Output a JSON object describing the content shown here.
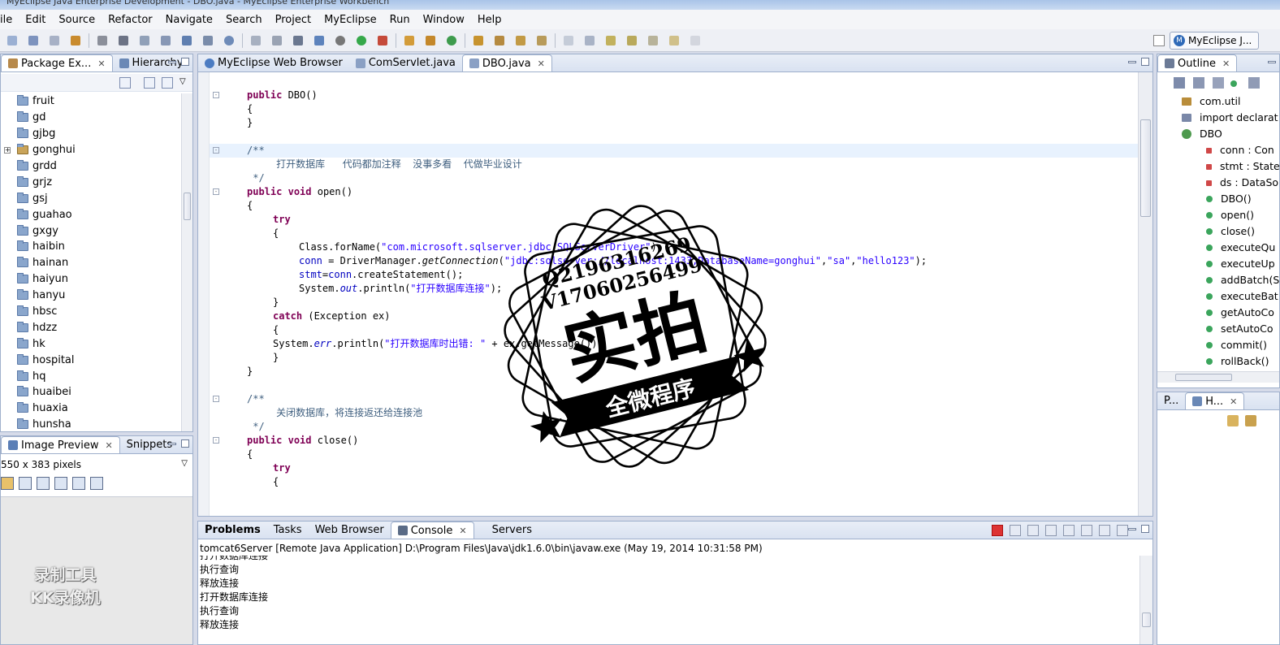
{
  "window": {
    "title": "MyEclipse Java Enterprise Development - DBO.java - MyEclipse Enterprise Workbench"
  },
  "menu": [
    "ile",
    "Edit",
    "Source",
    "Refactor",
    "Navigate",
    "Search",
    "Project",
    "MyEclipse",
    "Run",
    "Window",
    "Help"
  ],
  "perspective": {
    "label": "MyEclipse J..."
  },
  "package_explorer": {
    "tabs": [
      "Package Ex...",
      "Hierarchy"
    ],
    "items": [
      "fruit",
      "gd",
      "gjbg",
      "gonghui",
      "grdd",
      "grjz",
      "gsj",
      "guahao",
      "gxgy",
      "haibin",
      "hainan",
      "haiyun",
      "hanyu",
      "hbsc",
      "hdzz",
      "hk",
      "hospital",
      "hq",
      "huaibei",
      "huaxia",
      "hunsha"
    ]
  },
  "image_preview": {
    "tabs": [
      "Image Preview",
      "Snippets"
    ],
    "size_text": "550 x 383 pixels",
    "watermark": [
      "录制工具",
      "KK录像机"
    ]
  },
  "editor": {
    "tabs": [
      "MyEclipse Web Browser",
      "ComServlet.java",
      "DBO.java"
    ],
    "code": {
      "l01_kw": "public",
      "l01_rest": " DBO()",
      "l02": "{",
      "l03": "}",
      "l05": "/**",
      "l06": "     打开数据库   代码都加注释  没事多看  代做毕业设计",
      "l07": " */",
      "l08_kw1": "public",
      "l08_kw2": "void",
      "l08_rest": " open()",
      "l09": "{",
      "l10_kw": "try",
      "l11": "{",
      "l12_a": "Class.forName(",
      "l12_str": "\"com.microsoft.sqlserver.jdbc.SQLServerDriver\"",
      "l12_b": ");",
      "l13_fld": "conn",
      "l13_a": " = DriverManager.",
      "l13_it": "getConnection",
      "l13_b": "(",
      "l13_str1": "\"jdbc:sqlserver://localhost:1433;DatabaseName=gonghui\"",
      "l13_c": ",",
      "l13_str2": "\"sa\"",
      "l13_d": ",",
      "l13_str3": "\"hello123\"",
      "l13_e": ");",
      "l14_fld": "stmt",
      "l14_a": "=",
      "l14_fld2": "conn",
      "l14_b": ".createStatement();",
      "l15_a": "System.",
      "l15_fld": "out",
      "l15_b": ".println(",
      "l15_str": "\"打开数据库连接\"",
      "l15_c": ");",
      "l16": "}",
      "l17_kw": "catch",
      "l17_rest": " (Exception ex)",
      "l18": "{",
      "l19_a": "System.",
      "l19_fld": "err",
      "l19_b": ".println(",
      "l19_str": "\"打开数据库时出错: \"",
      "l19_c": " + ex.getMessage());",
      "l20": "}",
      "l21": "}",
      "l23": "/**",
      "l24": "     关闭数据库，将连接返还给连接池",
      "l25": " */",
      "l26_kw1": "public",
      "l26_kw2": "void",
      "l26_rest": " close()",
      "l27": "{",
      "l28_kw": "try",
      "l29": "{"
    }
  },
  "console": {
    "tabs": [
      "Problems",
      "Tasks",
      "Web Browser",
      "Console",
      "Servers"
    ],
    "header": "tomcat6Server [Remote Java Application] D:\\Program Files\\Java\\jdk1.6.0\\bin\\javaw.exe (May 19, 2014 10:31:58 PM)",
    "lines": [
      "打开数据库连接",
      "执行查询",
      "释放连接",
      "打开数据库连接",
      "执行查询",
      "释放连接"
    ]
  },
  "outline": {
    "tab": "Outline",
    "items": [
      "com.util",
      "import declarat",
      "DBO",
      "conn : Con",
      "stmt : State",
      "ds : DataSo",
      "DBO()",
      "open()",
      "close()",
      "executeQu",
      "executeUp",
      "addBatch(S",
      "executeBat",
      "getAutoCo",
      "setAutoCo",
      "commit()",
      "rollBack()"
    ]
  },
  "hierarchy": {
    "tabs": [
      "P...",
      "H..."
    ]
  },
  "stamp": {
    "line1": "Q2196316269",
    "line2": "V17060256499",
    "big": "实拍",
    "banner": "全微程序"
  },
  "colors": {
    "keyword": "#7f0055",
    "string": "#2a00ff",
    "comment": "#3f5f7f",
    "field": "#0000c0"
  }
}
